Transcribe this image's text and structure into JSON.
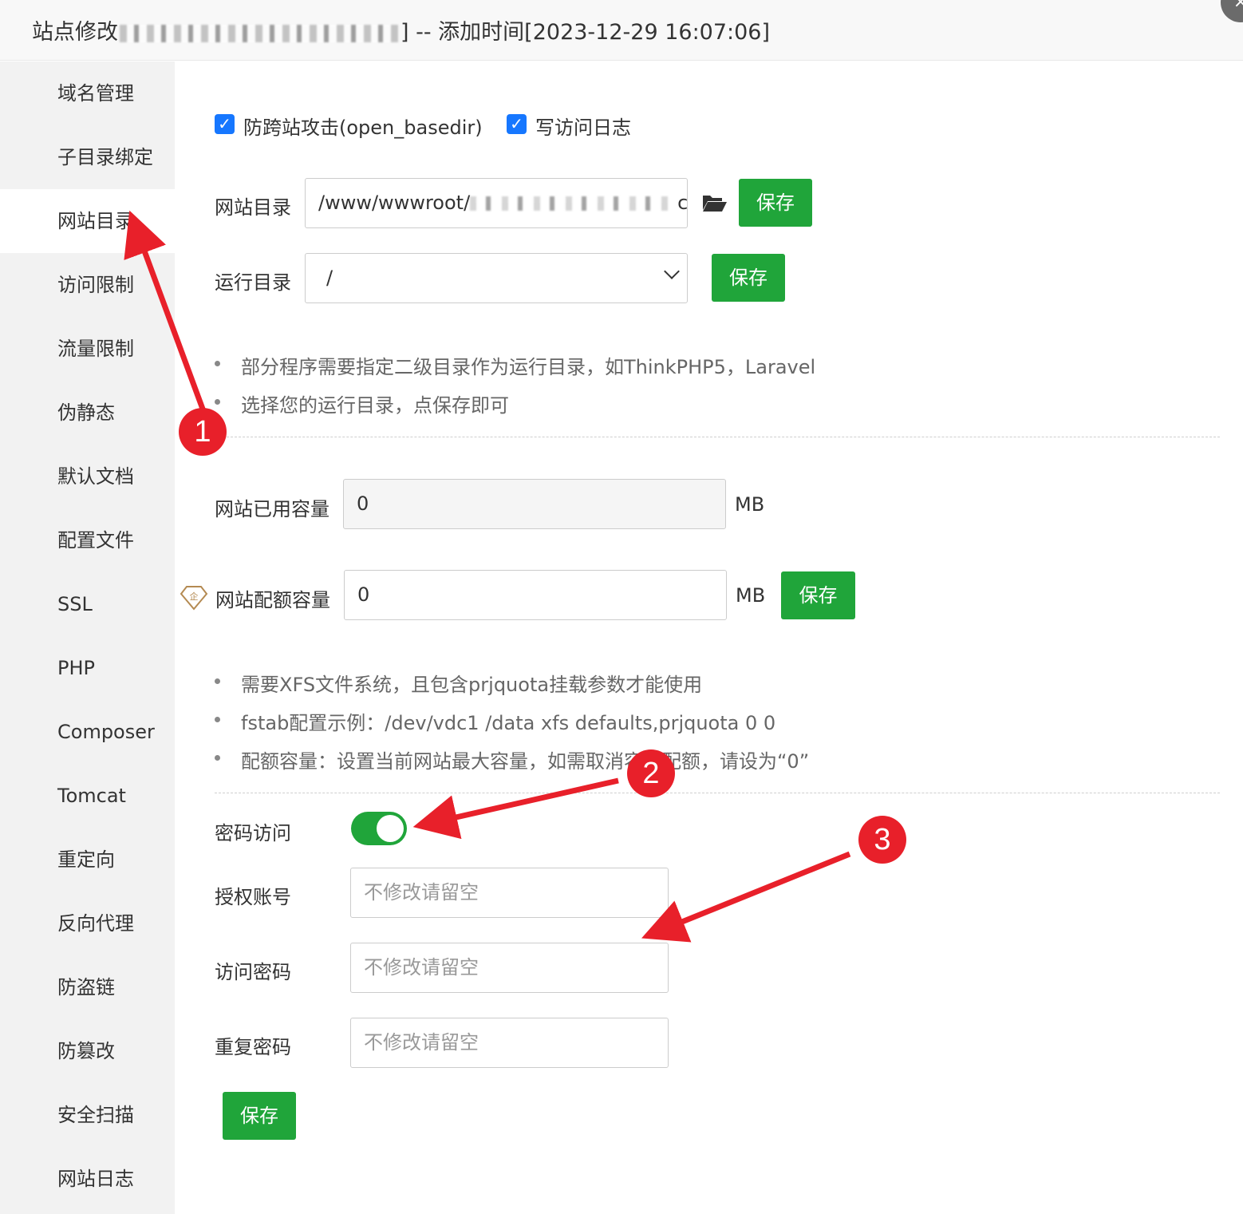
{
  "window": {
    "title_prefix": "站点修改",
    "title_suffix": "] -- 添加时间[2023-12-29 16:07:06]",
    "close_icon": "×"
  },
  "sidebar": {
    "items": [
      {
        "label": "域名管理"
      },
      {
        "label": "子目录绑定"
      },
      {
        "label": "网站目录",
        "active": true
      },
      {
        "label": "访问限制"
      },
      {
        "label": "流量限制"
      },
      {
        "label": "伪静态"
      },
      {
        "label": "默认文档"
      },
      {
        "label": "配置文件"
      },
      {
        "label": "SSL"
      },
      {
        "label": "PHP"
      },
      {
        "label": "Composer"
      },
      {
        "label": "Tomcat"
      },
      {
        "label": "重定向"
      },
      {
        "label": "反向代理"
      },
      {
        "label": "防盗链"
      },
      {
        "label": "防篡改"
      },
      {
        "label": "安全扫描"
      },
      {
        "label": "网站日志"
      }
    ]
  },
  "main": {
    "checkboxes": [
      {
        "label": "防跨站攻击(open_basedir)",
        "checked": true
      },
      {
        "label": "写访问日志",
        "checked": true
      }
    ],
    "site_dir": {
      "label": "网站目录",
      "value": "/www/wwwroot/",
      "value_tail": "c",
      "save_label": "保存"
    },
    "run_dir": {
      "label": "运行目录",
      "value": "/",
      "save_label": "保存"
    },
    "run_tips": [
      "部分程序需要指定二级目录作为运行目录，如ThinkPHP5，Laravel",
      "选择您的运行目录，点保存即可"
    ],
    "used_capacity": {
      "label": "网站已用容量",
      "value": "0",
      "unit": "MB"
    },
    "quota_capacity": {
      "label": "网站配额容量",
      "value": "0",
      "unit": "MB",
      "save_label": "保存",
      "badge_glyph": "企"
    },
    "quota_tips": [
      "需要XFS文件系统，且包含prjquota挂载参数才能使用",
      "fstab配置示例：/dev/vdc1 /data xfs defaults,prjquota 0 0",
      "配额容量：设置当前网站最大容量，如需取消容量配额，请设为“0”"
    ],
    "password_access": {
      "label": "密码访问",
      "enabled": true
    },
    "auth_account": {
      "label": "授权账号",
      "placeholder": "不修改请留空"
    },
    "access_password": {
      "label": "访问密码",
      "placeholder": "不修改请留空"
    },
    "repeat_password": {
      "label": "重复密码",
      "placeholder": "不修改请留空"
    },
    "save_label": "保存"
  },
  "annotations": {
    "badges": [
      "1",
      "2",
      "3"
    ],
    "color": "#e8202a"
  }
}
